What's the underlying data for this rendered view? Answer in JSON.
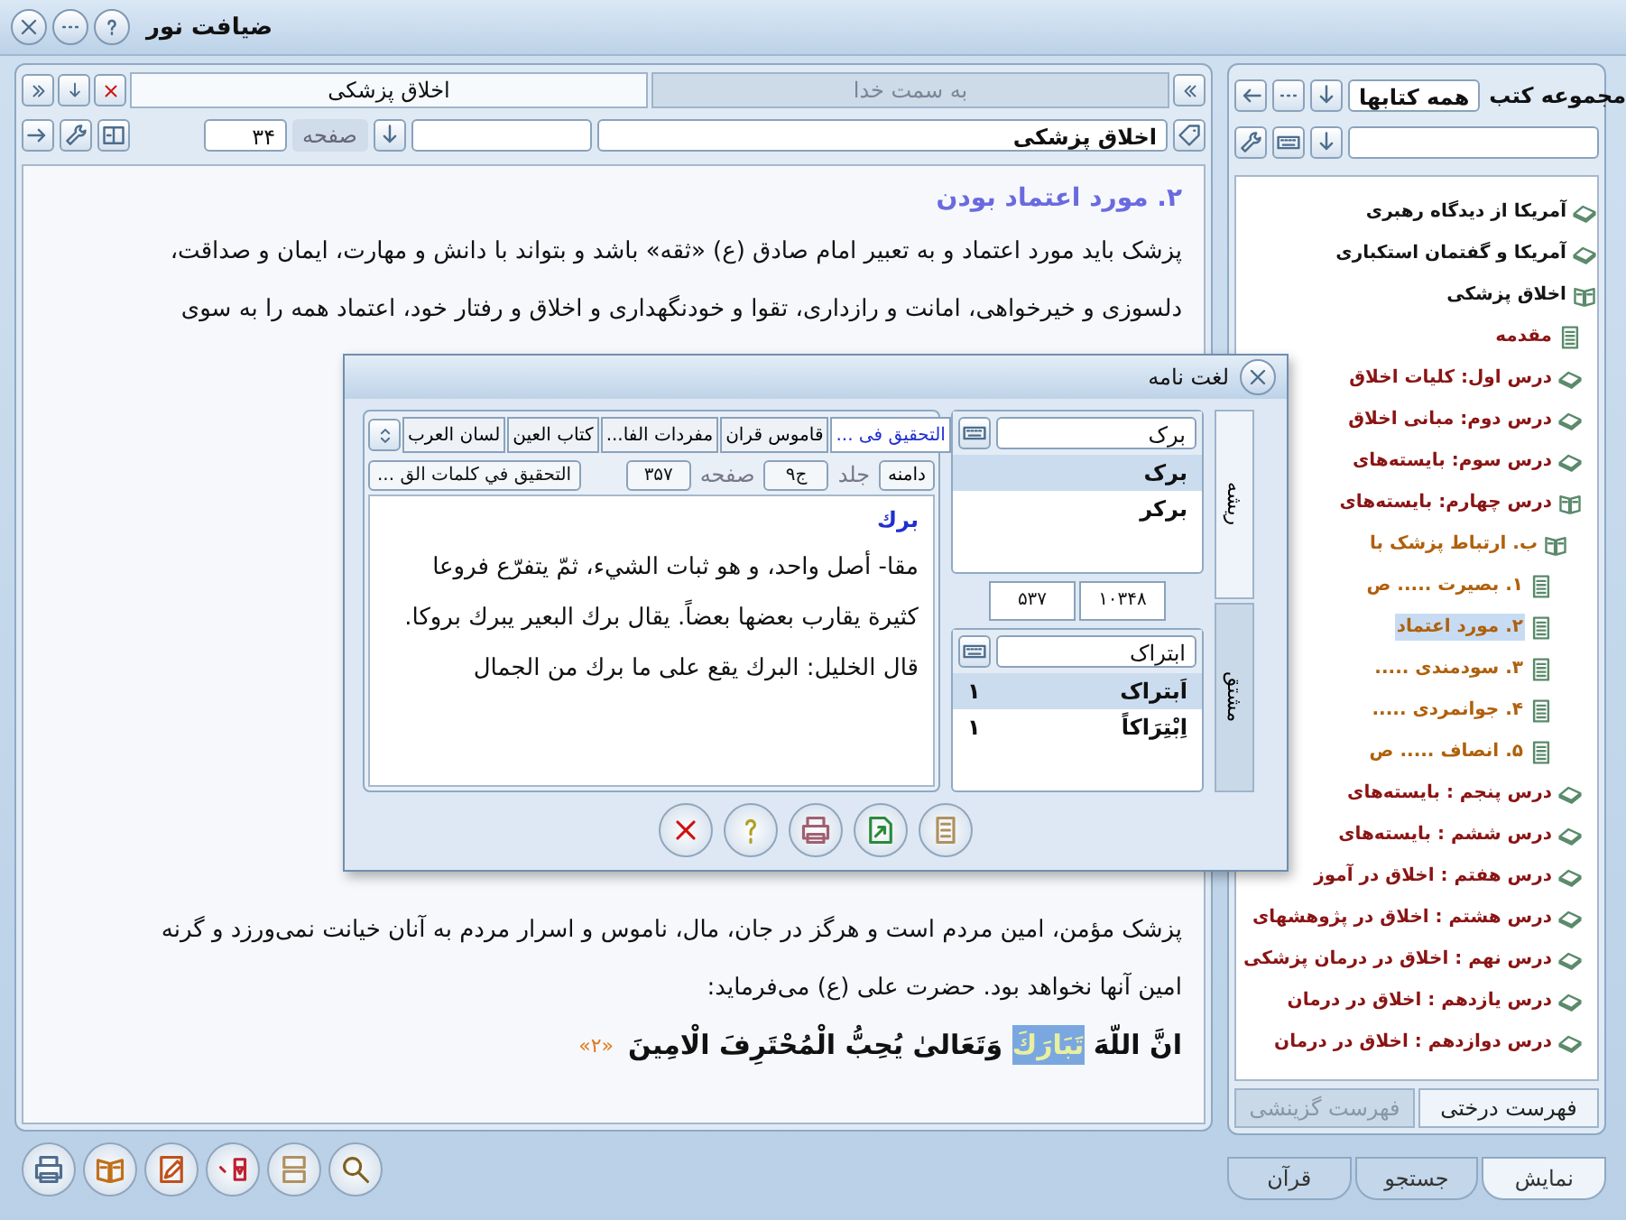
{
  "window": {
    "title": "ضیافت نور"
  },
  "reader": {
    "tabs": [
      {
        "label": "به سمت خدا",
        "selected": false
      },
      {
        "label": "اخلاق پزشکی",
        "selected": true
      }
    ],
    "book_field": "اخلاق پزشکی",
    "page_label": "صفحه",
    "page_value": "۳۴",
    "heading": "۲. مورد اعتماد بودن",
    "lines_top": [
      "پزشک باید مورد اعتماد و به تعبیر امام صادق (ع) «ثقه» باشد و بتواند با دانش و مهارت، ایمان و صداقت،",
      "دلسوزی و خیرخواهی، امانت و رازداری، تقوا و خودنگهداری و اخلاق و رفتار خود، اعتماد همه را به سوی"
    ],
    "lines_bottom": [
      "پزشک مؤمن، امین مردم است و هرگز در جان، مال، ناموس و اسرار مردم به آنان خیانت نمی‌ورزد و گرنه",
      "امین آنها نخواهد بود. حضرت علی (ع) می‌فرماید:"
    ],
    "verse": {
      "before": "انَّ اللّهَ ",
      "highlight": "تَبَارَكَ",
      "after": " وَتَعَالىٰ يُحِبُّ الْمُحْتَرِفَ الْامِينَ",
      "footnote": "«۲»"
    }
  },
  "library": {
    "label": "مجموعه کتب",
    "collection": "همه کتابها",
    "tree": [
      {
        "kind": "book",
        "label": "آمریکا از دیدگاه رهبری",
        "selected": false
      },
      {
        "kind": "book",
        "label": "آمریکا و گفتمان استکباری",
        "selected": false
      },
      {
        "kind": "open",
        "label": "اخلاق پزشکی",
        "selected": false,
        "children": [
          {
            "kind": "doc",
            "label": "مقدمه",
            "selected": false
          },
          {
            "kind": "book",
            "label": "درس اول: کلیات اخلاق",
            "selected": false
          },
          {
            "kind": "book",
            "label": "درس دوم: مبانی اخلاق",
            "selected": false
          },
          {
            "kind": "book",
            "label": "درس سوم: بایسته‌های",
            "selected": false
          },
          {
            "kind": "open",
            "label": "درس چهارم: بایسته‌های",
            "selected": false,
            "children": [
              {
                "kind": "open",
                "label": "ب. ارتباط پزشک با",
                "selected": false,
                "children": [
                  {
                    "kind": "doc",
                    "label": "۱. بصیرت ..... ص",
                    "selected": false
                  },
                  {
                    "kind": "doc",
                    "label": "۲. مورد اعتماد",
                    "selected": true
                  },
                  {
                    "kind": "doc",
                    "label": "۳. سودمندی .....",
                    "selected": false
                  },
                  {
                    "kind": "doc",
                    "label": "۴. جوانمردی .....",
                    "selected": false
                  },
                  {
                    "kind": "doc",
                    "label": "۵. انصاف ..... ص",
                    "selected": false
                  }
                ]
              }
            ]
          },
          {
            "kind": "book",
            "label": "درس پنجم : بایسته‌های",
            "selected": false
          },
          {
            "kind": "book",
            "label": "درس ششم : بایسته‌های",
            "selected": false
          },
          {
            "kind": "book",
            "label": "درس هفتم : اخلاق در آموز",
            "selected": false
          },
          {
            "kind": "book",
            "label": "درس هشتم : اخلاق در پژوهشهای",
            "selected": false
          },
          {
            "kind": "book",
            "label": "درس نهم : اخلاق در درمان پزشکی",
            "selected": false
          },
          {
            "kind": "book",
            "label": "درس یازدهم : اخلاق در درمان",
            "selected": false
          },
          {
            "kind": "book",
            "label": "درس دوازدهم : اخلاق در درمان",
            "selected": false
          }
        ]
      }
    ],
    "tree_tabs": [
      {
        "label": "فهرست درختی",
        "selected": true
      },
      {
        "label": "فهرست گزینشی",
        "selected": false
      }
    ]
  },
  "bottom_tabs": [
    {
      "label": "نمایش",
      "selected": true
    },
    {
      "label": "جستجو",
      "selected": false
    },
    {
      "label": "قرآن",
      "selected": false
    }
  ],
  "dictionary": {
    "title": "لغت نامه",
    "side_tabs": [
      {
        "label": "ریشه",
        "selected": true
      },
      {
        "label": "مشتق",
        "selected": false
      }
    ],
    "root_search": "برک",
    "roots": [
      {
        "word": "برک",
        "selected": true
      },
      {
        "word": "برکر",
        "selected": false
      }
    ],
    "counter": [
      "۱۰۳۴۸",
      "۵۳۷"
    ],
    "derived_search": "ابتراک",
    "derived": [
      {
        "word": "اَبتراک",
        "count": "۱",
        "selected": true
      },
      {
        "word": "اِبْتِرَاکاً",
        "count": "۱",
        "selected": false
      }
    ],
    "source_tabs": [
      {
        "label": "التحقیق فی ...",
        "selected": true
      },
      {
        "label": "قاموس قران",
        "selected": false
      },
      {
        "label": "مفردات الفا...",
        "selected": false
      },
      {
        "label": "كتاب العين",
        "selected": false
      },
      {
        "label": "لسان العرب",
        "selected": false
      }
    ],
    "range_label": "دامنه",
    "volume_label": "جلد",
    "volume": "ج۹",
    "page_label": "صفحه",
    "page": "۳۵۷",
    "source_title": "التحقيق في كلمات الق ...",
    "entry_title": "برك",
    "entry_text": "مقا- أصل واحد، و هو ثبات الشيء، ثمّ يتفرّع فروعا كثيرة يقارب بعضها بعضاً. يقال برك البعير يبرك بروكا. قال الخليل: البرك يقع على ما برك من الجمال"
  }
}
